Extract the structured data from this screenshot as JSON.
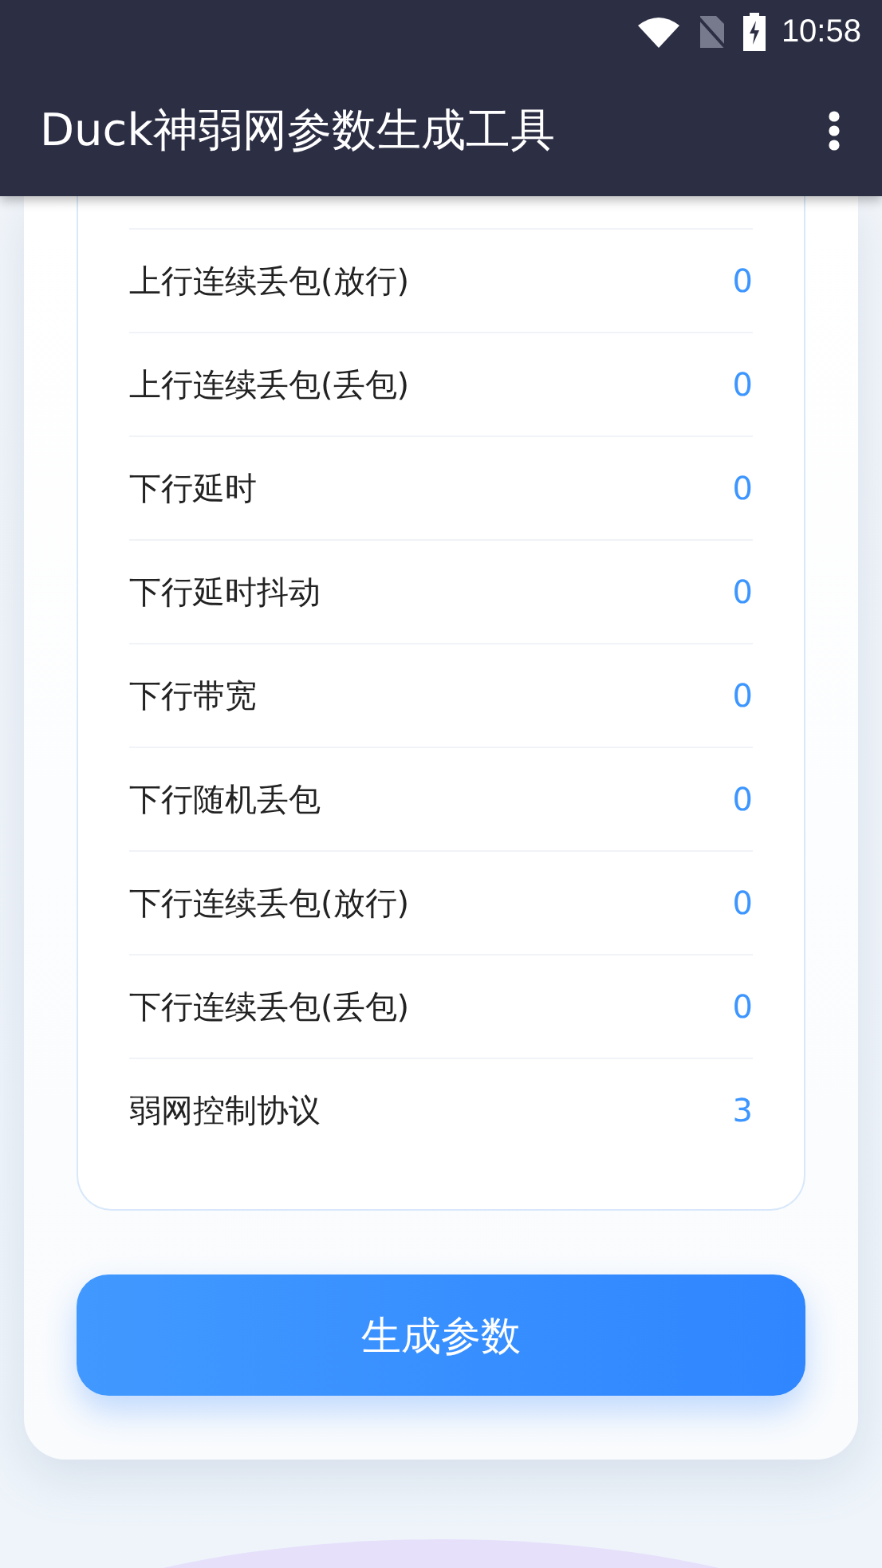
{
  "status_bar": {
    "time": "10:58"
  },
  "app_bar": {
    "title": "Duck神弱网参数生成工具"
  },
  "params": [
    {
      "label": "上行连续丢包(放行)",
      "value": "0"
    },
    {
      "label": "上行连续丢包(丢包)",
      "value": "0"
    },
    {
      "label": "下行延时",
      "value": "0"
    },
    {
      "label": "下行延时抖动",
      "value": "0"
    },
    {
      "label": "下行带宽",
      "value": "0"
    },
    {
      "label": "下行随机丢包",
      "value": "0"
    },
    {
      "label": "下行连续丢包(放行)",
      "value": "0"
    },
    {
      "label": "下行连续丢包(丢包)",
      "value": "0"
    },
    {
      "label": "弱网控制协议",
      "value": "3"
    }
  ],
  "button": "生成参数"
}
